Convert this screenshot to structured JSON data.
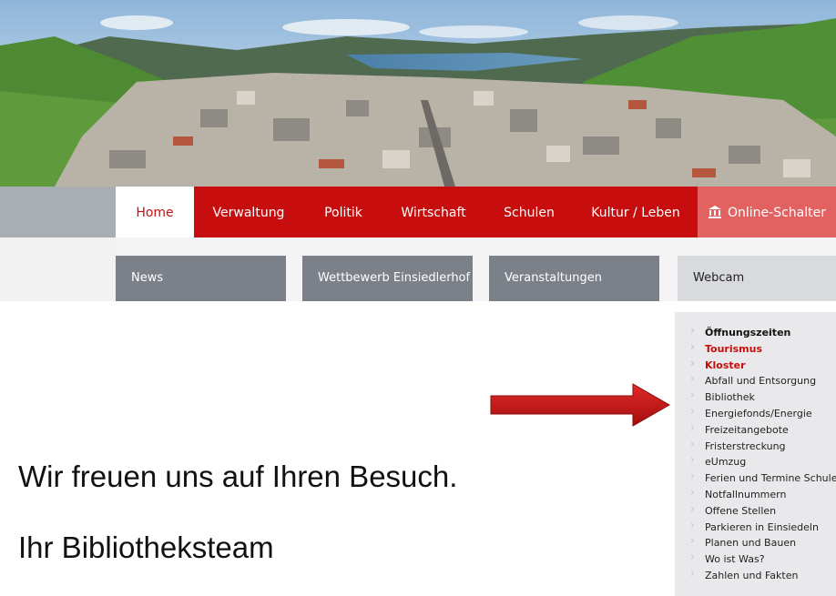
{
  "banner": {
    "alt_icon": "landscape-photo"
  },
  "nav": {
    "items": [
      "Home",
      "Verwaltung",
      "Politik",
      "Wirtschaft",
      "Schulen",
      "Kultur / Leben"
    ],
    "active": "Home",
    "online_label": "Online-Schalter",
    "online_icon": "building-columns-icon",
    "accent": "#c70d0d"
  },
  "subnav": [
    "News",
    "Wettbewerb Einsiedlerhof",
    "Veranstaltungen",
    "Webcam"
  ],
  "sidemenu": [
    "Öffnungszeiten",
    "Tourismus",
    "Kloster",
    "Abfall und Entsorgung",
    "Bibliothek",
    "Energiefonds/Energie",
    "Freizeitangebote",
    "Fristerstreckung",
    "eUmzug",
    "Ferien und Termine Schulen",
    "Notfallnummern",
    "Offene Stellen",
    "Parkieren in Einsiedeln",
    "Planen und Bauen",
    "Wo ist Was?",
    "Zahlen und Fakten"
  ],
  "message": {
    "line1": "Wir freuen uns auf Ihren Besuch.",
    "line2": "Ihr Bibliotheksteam"
  }
}
